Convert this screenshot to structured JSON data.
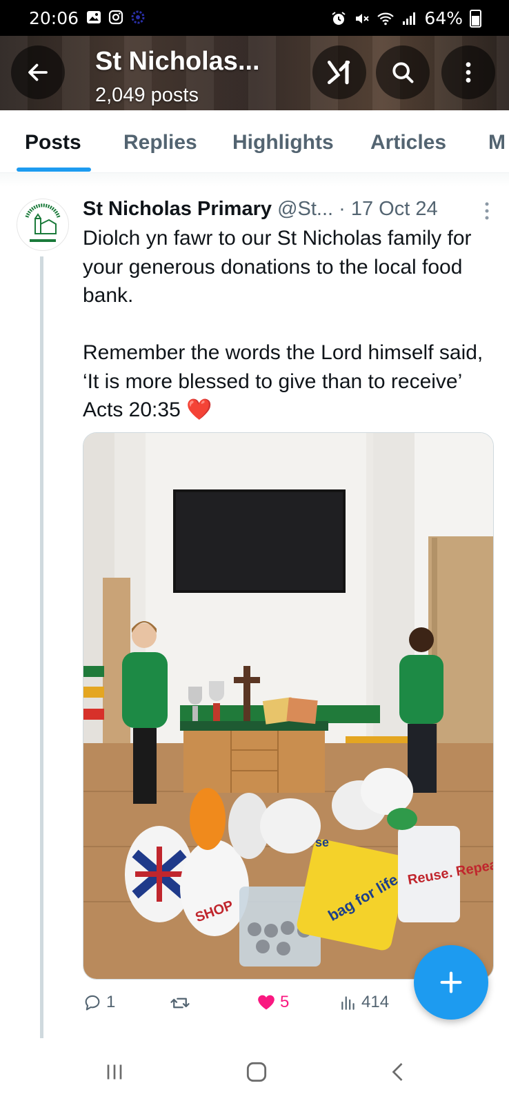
{
  "status_bar": {
    "time": "20:06",
    "battery_text": "64%",
    "icons_left": [
      "gallery-icon",
      "instagram-icon",
      "app-icon"
    ],
    "icons_right": [
      "alarm-icon",
      "mute-icon",
      "wifi-icon",
      "signal-icon",
      "battery-icon"
    ]
  },
  "header": {
    "title": "St Nicholas...",
    "subtitle": "2,049 posts",
    "xai_label": "x̸I"
  },
  "tabs": [
    {
      "label": "Posts",
      "active": true
    },
    {
      "label": "Replies",
      "active": false
    },
    {
      "label": "Highlights",
      "active": false
    },
    {
      "label": "Articles",
      "active": false
    },
    {
      "label": "M",
      "active": false
    }
  ],
  "post": {
    "author_name": "St Nicholas Primary",
    "handle": "@St...",
    "date": "· 17 Oct 24",
    "text_lines": [
      "Diolch yn fawr to our St Nicholas family for your generous donations to the local food bank.",
      "Remember the words the Lord himself said,  ‘It is more blessed to give than to receive’ Acts 20:35 ❤️"
    ],
    "photo_labels": {
      "bag_reuse": "Reuse. Repeat",
      "bag_life": "bag for life",
      "bag_short": "se"
    },
    "stats": {
      "replies": "1",
      "reposts": "",
      "likes": "5",
      "views": "414"
    }
  },
  "colors": {
    "accent": "#1d9bf0",
    "like": "#f91880",
    "muted": "#536471",
    "school_green": "#1a7a3a"
  }
}
